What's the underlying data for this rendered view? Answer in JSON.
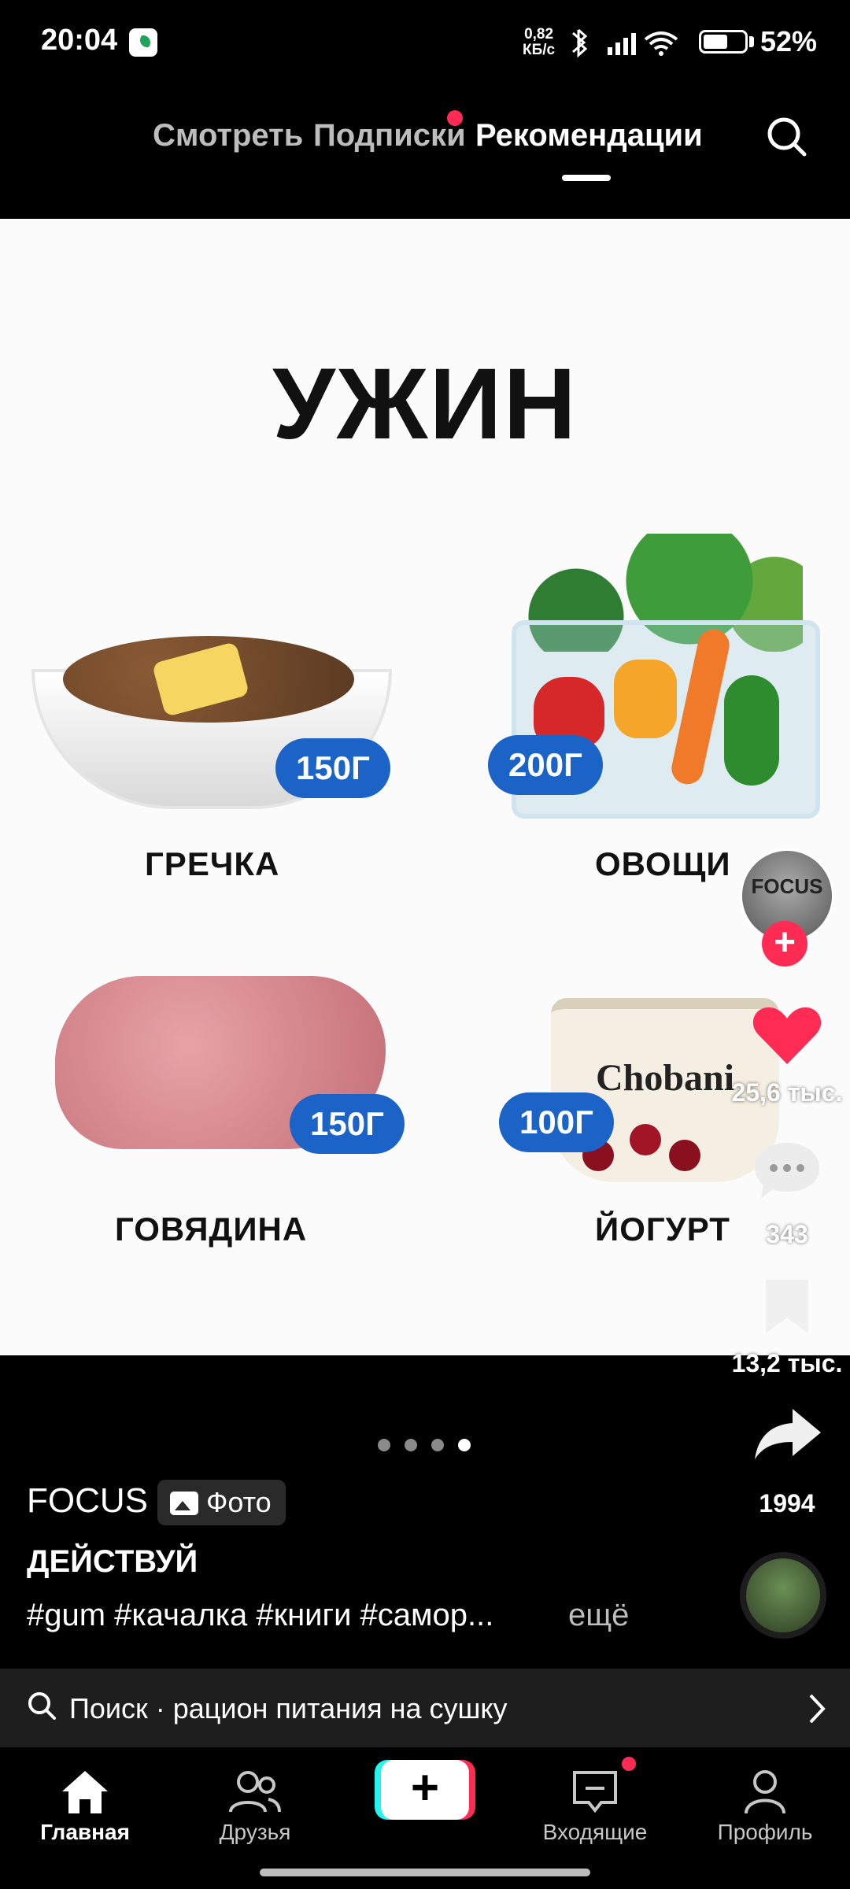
{
  "status_bar": {
    "time": "20:04",
    "network_speed_value": "0,82",
    "network_speed_unit": "КБ/с",
    "battery": "52%"
  },
  "top_tabs": [
    "Смотреть",
    "Подписки",
    "Рекомендации"
  ],
  "content": {
    "title": "УЖИН",
    "items": [
      {
        "name": "ГРЕЧКА",
        "amount": "150Г"
      },
      {
        "name": "ОВОЩИ",
        "amount": "200Г"
      },
      {
        "name": "ГОВЯДИНА",
        "amount": "150Г"
      },
      {
        "name": "ЙОГУРТ",
        "amount": "100Г"
      }
    ],
    "yogurt_brand": "Chobani"
  },
  "actions": {
    "avatar_text": "FOCUS",
    "likes": "25,6 тыс.",
    "comments": "343",
    "saves": "13,2 тыс.",
    "shares": "1994"
  },
  "carousel": {
    "total": 4,
    "active_index": 3
  },
  "caption": {
    "author": "FOCUS",
    "type_tag": "Фото",
    "title": "ДЕЙСТВУЙ",
    "hashtags": "#gum #качалка #книги #самор...",
    "more": "ещё"
  },
  "search_bar": {
    "label": "Поиск · рацион питания на сушку"
  },
  "bottom_nav": {
    "home": "Главная",
    "friends": "Друзья",
    "inbox": "Входящие",
    "profile": "Профиль"
  },
  "colors": {
    "accent": "#fe2c55",
    "badge": "#1b63c6",
    "teal": "#25f4ee"
  }
}
